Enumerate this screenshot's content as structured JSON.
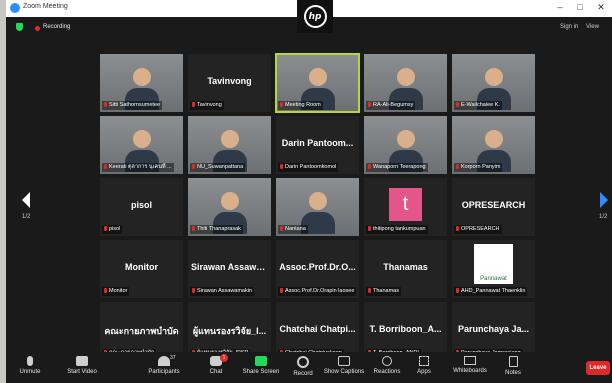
{
  "window": {
    "title": "Zoom Meeting",
    "minimize": "–",
    "maximize": "□",
    "close": "✕"
  },
  "brand": {
    "logo_text": "hp"
  },
  "status": {
    "recording": "Recording",
    "sign_in": "Sign in",
    "view": "View"
  },
  "pagination": {
    "left": "1/2",
    "right": "1/2"
  },
  "participants": [
    {
      "label": "Sitti Sathornsumetee",
      "big_name": "",
      "video": true
    },
    {
      "label": "Tavinvong",
      "big_name": "Tavinvong",
      "video": false
    },
    {
      "label": "Meeting Room",
      "big_name": "",
      "video": true,
      "active": true
    },
    {
      "label": "RA-Ali-Begumsy",
      "big_name": "",
      "video": true
    },
    {
      "label": "E-Wailchaiee K.",
      "big_name": "",
      "video": true
    },
    {
      "label": "Keerati ตุลาการ นุเคนทิ์ ...",
      "big_name": "",
      "video": true
    },
    {
      "label": "NU_Suwanpattana",
      "big_name": "",
      "video": true
    },
    {
      "label": "Darin Pantoomkomol",
      "big_name": "Darin Pantoom...",
      "video": false
    },
    {
      "label": "Wanaporn Teerapong",
      "big_name": "",
      "video": true
    },
    {
      "label": "Korporn Panyim",
      "big_name": "",
      "video": true
    },
    {
      "label": "pisol",
      "big_name": "pisol",
      "video": false
    },
    {
      "label": "Thiti Thanaprasak",
      "big_name": "",
      "video": true
    },
    {
      "label": "Nantana",
      "big_name": "",
      "video": true
    },
    {
      "label": "thitipong tankumpuan",
      "big_name": "",
      "video": false,
      "avatar_letter": "t"
    },
    {
      "label": "OPRESEARCH",
      "big_name": "OPRESEARCH",
      "video": false
    },
    {
      "label": "Monitor",
      "big_name": "Monitor",
      "video": false
    },
    {
      "label": "Sirawan Assawamakin",
      "big_name": "Sirawan Assawa...",
      "video": false
    },
    {
      "label": "Assoc.Prof.Dr.Orapin laosee",
      "big_name": "Assoc.Prof.Dr.O...",
      "video": false
    },
    {
      "label": "Thanamas",
      "big_name": "Thanamas",
      "video": false
    },
    {
      "label": "AHD_Pannawat Thaenklin",
      "big_name": "",
      "video": false,
      "logo_text": "Pannawat"
    },
    {
      "label": "คณะกายภาพบำบัด",
      "big_name": "คณะกายภาพบำบัด",
      "video": false
    },
    {
      "label": "ผู้แทนรองรวิจัย_IPSR",
      "big_name": "ผู้แทนรองรวิจัย_I...",
      "video": false
    },
    {
      "label": "Chatchai Chatpiyakoop",
      "big_name": "Chatchai Chatpi...",
      "video": false
    },
    {
      "label": "T. Borriboon_ANDI",
      "big_name": "T. Borriboon_A...",
      "video": false
    },
    {
      "label": "Parunchaya Jamroajang",
      "big_name": "Parunchaya Ja...",
      "video": false
    }
  ],
  "toolbar": {
    "unmute": "Unmute",
    "start_video": "Start Video",
    "participants": "Participants",
    "participants_count": "37",
    "chat": "Chat",
    "chat_badge": "1",
    "share_screen": "Share Screen",
    "record": "Record",
    "show_captions": "Show Captions",
    "reactions": "Reactions",
    "apps": "Apps",
    "whiteboards": "Whiteboards",
    "notes": "Notes",
    "leave": "Leave"
  },
  "colors": {
    "accent": "#2d8cff",
    "active_speaker": "#b8d62e",
    "leave": "#e02828",
    "share": "#23d959"
  }
}
